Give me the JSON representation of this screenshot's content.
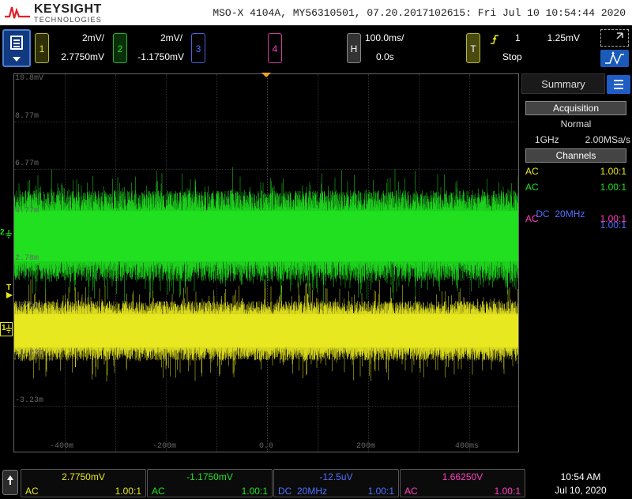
{
  "titlebar": {
    "logo_name": "KEYSIGHT",
    "logo_sub": "TECHNOLOGIES",
    "title": "MSO-X 4104A, MY56310501, 07.20.2017102615: Fri Jul 10 10:54:44 2020"
  },
  "channels": [
    {
      "num": "1",
      "scale": "2mV/",
      "offset": "2.7750mV",
      "color": "#e8e820"
    },
    {
      "num": "2",
      "scale": "2mV/",
      "offset": "-1.1750mV",
      "color": "#20e020"
    },
    {
      "num": "3",
      "color": "#5070ff"
    },
    {
      "num": "4",
      "color": "#ff40c0"
    }
  ],
  "horizontal": {
    "tag": "H",
    "timebase": "100.0ms/",
    "delay": "0.0s"
  },
  "trigger": {
    "tag": "T",
    "edge_icon": "rising-edge-icon",
    "source": "1",
    "level": "1.25mV",
    "status": "Stop"
  },
  "graticule": {
    "y_ticks": [
      "10.8mV",
      "8.77m",
      "6.77m",
      "4.77m",
      "2.78m",
      ".775m",
      "-1.23m",
      "-3.23m"
    ],
    "x_ticks": [
      "-400m",
      "-200m",
      "0.0",
      "200m",
      "400ms"
    ]
  },
  "markers": {
    "trigger": "T",
    "ch2": "2",
    "ch1": "1"
  },
  "summary_panel": {
    "tab_label": "Summary",
    "acquisition_header": "Acquisition",
    "acq_mode": "Normal",
    "acq_rate_left": "1GHz",
    "acq_rate_right": "2.00MSa/s",
    "channels_header": "Channels",
    "channel_rows": [
      {
        "coupling": "AC",
        "probe": "1.00:1",
        "color": "#e8e820"
      },
      {
        "coupling": "AC",
        "probe": "1.00:1",
        "color": "#20e020"
      },
      {
        "coupling": "DC  20MHz",
        "probe": "1.00:1",
        "color": "#5070ff"
      },
      {
        "coupling": "AC",
        "probe": "1.00:1",
        "color": "#ff40c0"
      }
    ]
  },
  "bottom_cells": [
    {
      "value": "2.7750mV",
      "coupling": "AC",
      "probe": "1.00:1",
      "color": "#e8e820"
    },
    {
      "value": "-1.1750mV",
      "coupling": "AC",
      "probe": "1.00:1",
      "color": "#20e020"
    },
    {
      "value": "-12.5uV",
      "coupling": "DC  20MHz",
      "probe": "1.00:1",
      "color": "#5070ff"
    },
    {
      "value": "1.66250V",
      "coupling": "AC",
      "probe": "1.00:1",
      "color": "#ff40c0"
    }
  ],
  "clock": {
    "time": "10:54 AM",
    "date": "Jul 10, 2020"
  }
}
